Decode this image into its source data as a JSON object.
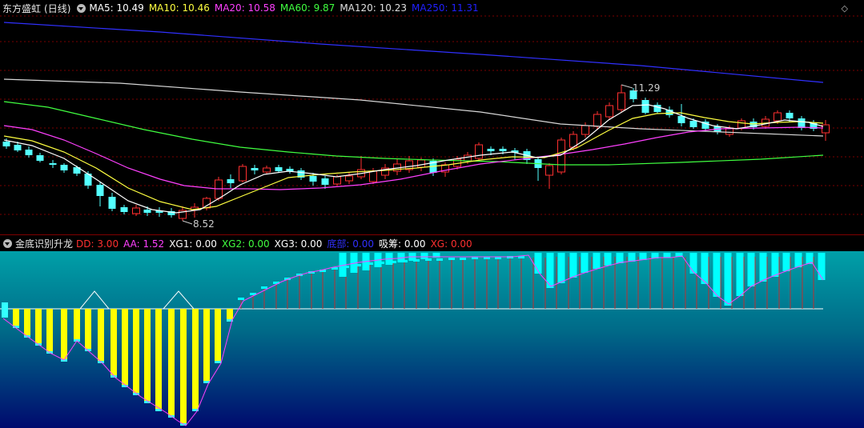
{
  "main": {
    "stock_name": "东方盛虹",
    "period": "(日线)",
    "ma": [
      {
        "label": "MA5: 10.49",
        "color": "#ffffff"
      },
      {
        "label": "MA10: 10.46",
        "color": "#ffff40"
      },
      {
        "label": "MA20: 10.58",
        "color": "#ff40ff"
      },
      {
        "label": "MA60: 9.87",
        "color": "#40ff40"
      },
      {
        "label": "MA120: 10.23",
        "color": "#e0e0e0"
      },
      {
        "label": "MA250: 11.31",
        "color": "#2020ff"
      }
    ],
    "high_label": "11.29",
    "low_label": "8.52"
  },
  "indicator": {
    "name": "金底识别升龙",
    "values": [
      {
        "label": "DD: 3.00",
        "color": "#ff3030"
      },
      {
        "label": "AA: 1.52",
        "color": "#ff40ff"
      },
      {
        "label": "XG1: 0.00",
        "color": "#ffffff"
      },
      {
        "label": "XG2: 0.00",
        "color": "#40ff40"
      },
      {
        "label": "XG3: 0.00",
        "color": "#ffffff"
      },
      {
        "label": "底部: 0.00",
        "color": "#3030ff"
      },
      {
        "label": "吸筹: 0.00",
        "color": "#ffffff"
      },
      {
        "label": "XG: 0.00",
        "color": "#ff3030"
      }
    ]
  },
  "colors": {
    "up": "#ff3030",
    "down": "#54ffff",
    "yellow_bar": "#ffff00",
    "cyan_bar": "#00ffff"
  },
  "chart_data": {
    "type": "candlestick",
    "price_min": 8.52,
    "price_max": 11.29,
    "candles_ohlc_description": "daily candles",
    "icons": [
      "collapse-icon",
      "diamond-icon"
    ]
  }
}
